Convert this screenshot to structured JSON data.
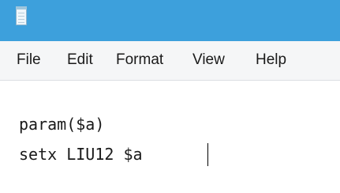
{
  "titlebar": {
    "icon": "notepad-icon",
    "color": "#3da0dc"
  },
  "menu": {
    "items": [
      {
        "label": "File"
      },
      {
        "label": "Edit"
      },
      {
        "label": "Format"
      },
      {
        "label": "View"
      },
      {
        "label": "Help"
      }
    ]
  },
  "editor": {
    "lines": [
      "param($a)",
      "setx LIU12 $a "
    ]
  }
}
